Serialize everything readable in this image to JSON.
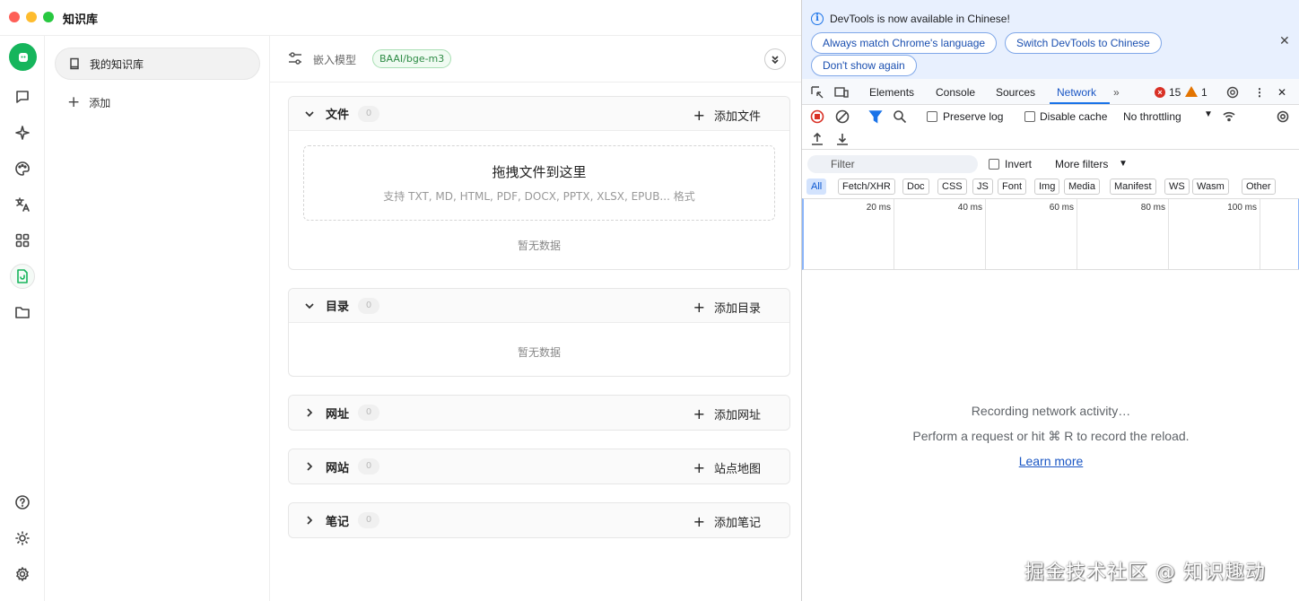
{
  "app": {
    "title": "知识库"
  },
  "sidebar": {
    "knowledge_base_item": "我的知识库",
    "add_label": "添加"
  },
  "main": {
    "embed_label": "嵌入模型",
    "model_tag": "BAAI/bge-m3",
    "sections": [
      {
        "title": "文件",
        "count": "0",
        "action": "添加文件",
        "expanded": true
      },
      {
        "title": "目录",
        "count": "0",
        "action": "添加目录",
        "expanded": true
      },
      {
        "title": "网址",
        "count": "0",
        "action": "添加网址",
        "expanded": false
      },
      {
        "title": "网站",
        "count": "0",
        "action": "站点地图",
        "expanded": false
      },
      {
        "title": "笔记",
        "count": "0",
        "action": "添加笔记",
        "expanded": false
      }
    ],
    "dropzone_title": "拖拽文件到这里",
    "dropzone_sub": "支持 TXT, MD, HTML, PDF, DOCX, PPTX, XLSX, EPUB... 格式",
    "empty_text": "暂无数据"
  },
  "devtools": {
    "info_message": "DevTools is now available in Chinese!",
    "btn_match_language": "Always match Chrome's language",
    "btn_switch_chinese": "Switch DevTools to Chinese",
    "btn_dont_show": "Don't show again",
    "tabs": [
      "Elements",
      "Console",
      "Sources",
      "Network"
    ],
    "active_tab": "Network",
    "error_count": "15",
    "warning_count": "1",
    "preserve_log": "Preserve log",
    "disable_cache": "Disable cache",
    "throttling": "No throttling",
    "filter_placeholder": "Filter",
    "invert": "Invert",
    "more_filters": "More filters",
    "chips": [
      "All",
      "Fetch/XHR",
      "Doc",
      "CSS",
      "JS",
      "Font",
      "Img",
      "Media",
      "Manifest",
      "WS",
      "Wasm",
      "Other"
    ],
    "timeline_labels": [
      "20 ms",
      "40 ms",
      "60 ms",
      "80 ms",
      "100 ms"
    ],
    "recording": "Recording network activity…",
    "perform_hint": "Perform a request or hit ⌘ R to record the reload.",
    "learn_more": "Learn more"
  },
  "watermark": "掘金技术社区 @ 知识趣动",
  "colors": {
    "accent_green": "#16b55c",
    "devtools_blue": "#1a73e8",
    "error_red": "#d93025",
    "warning_orange": "#e37400"
  }
}
